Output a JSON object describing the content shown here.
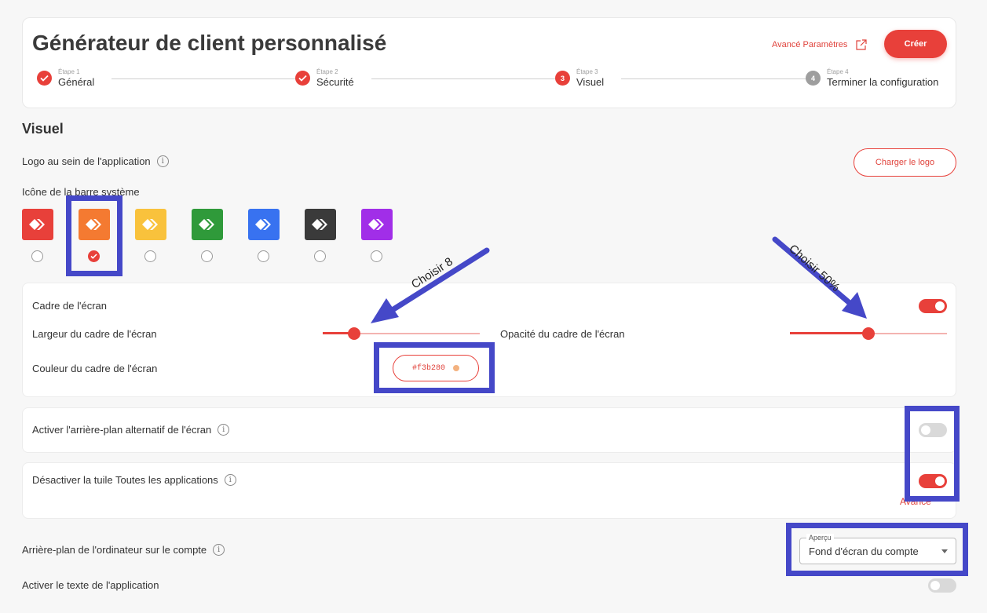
{
  "header": {
    "title": "Générateur de client personnalisé",
    "advanced_link": "Avancé Paramètres",
    "create_button": "Créer"
  },
  "steps": [
    {
      "sub": "Étape 1",
      "name": "Général",
      "state": "done",
      "num": ""
    },
    {
      "sub": "Étape 2",
      "name": "Sécurité",
      "state": "done",
      "num": ""
    },
    {
      "sub": "Étape 3",
      "name": "Visuel",
      "state": "current",
      "num": "3"
    },
    {
      "sub": "Étape 4",
      "name": "Terminer la configuration",
      "state": "pending",
      "num": "4"
    }
  ],
  "visual": {
    "section_title": "Visuel",
    "logo_label": "Logo au sein de l'application",
    "logo_button": "Charger le logo",
    "tray_icon_label": "Icône de la barre système",
    "tray_icons": [
      {
        "color": "#e8403a",
        "icon": "anydesk-logo-icon",
        "selected": false
      },
      {
        "color": "#f47a31",
        "icon": "anydesk-logo-icon",
        "selected": true
      },
      {
        "color": "#f9c23c",
        "icon": "anydesk-logo-icon",
        "selected": false
      },
      {
        "color": "#2f9a3a",
        "icon": "anydesk-logo-icon",
        "selected": false
      },
      {
        "color": "#3872f0",
        "icon": "anydesk-logo-icon",
        "selected": false
      },
      {
        "color": "#3a3a3a",
        "icon": "anydesk-logo-icon",
        "selected": false
      },
      {
        "color": "#a12ee8",
        "icon": "anydesk-logo-icon",
        "selected": false
      }
    ]
  },
  "frame": {
    "label": "Cadre de l'écran",
    "enabled": true,
    "width_label": "Largeur du cadre de l'écran",
    "width_value": 0.2,
    "opacity_label": "Opacité du cadre de l'écran",
    "opacity_value": 0.5,
    "color_label": "Couleur du cadre de l'écran",
    "color_value": "#f3b280"
  },
  "alt_background": {
    "label": "Activer l'arrière-plan alternatif de l'écran",
    "enabled": false
  },
  "all_apps_tile": {
    "label": "Désactiver la tuile Toutes les applications",
    "enabled": true,
    "advance_link": "Avance"
  },
  "desktop_bg": {
    "label": "Arrière-plan de l'ordinateur sur le compte",
    "select_legend": "Aperçu",
    "select_value": "Fond d'écran du compte"
  },
  "app_text": {
    "label": "Activer le texte de l'application",
    "enabled": false
  },
  "annotations": {
    "arrow1": "Choisir 8",
    "arrow2": "Choisir 50%"
  },
  "colors": {
    "accent": "#e8403a",
    "highlight": "#4548c8"
  }
}
